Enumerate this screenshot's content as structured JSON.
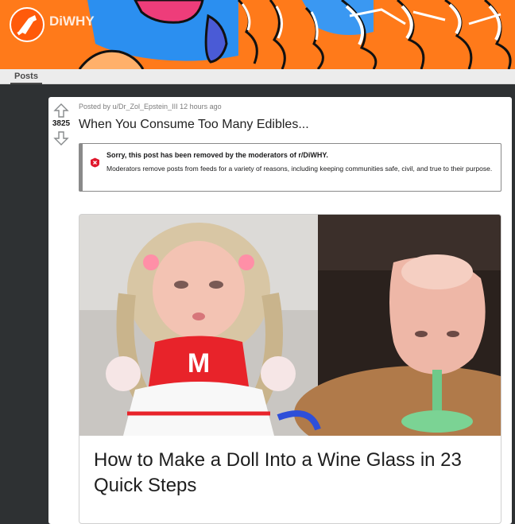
{
  "subreddit": {
    "name": "DiWHY",
    "logo_icon": "diwhy-logo-icon",
    "banner_color": "#ff7a1a"
  },
  "tabs": [
    {
      "label": "Posts",
      "active": true
    }
  ],
  "post": {
    "vote_count": "3825",
    "upvote_icon": "upvote-arrow-icon",
    "downvote_icon": "downvote-arrow-icon",
    "meta": "Posted by u/Dr_Zol_Epstein_III 12 hours ago",
    "title": "When You Consume Too Many Edibles...",
    "removal_notice": {
      "icon": "removed-x-icon",
      "heading": "Sorry, this post has been removed by the moderators of r/DiWHY.",
      "body": "Moderators remove posts from feeds for a variety of reasons, including keeping communities safe, civil, and true to their purpose."
    },
    "preview": {
      "image_description_icon": "doll-wine-glass-image",
      "overlay_title": "How to Make a Doll Into a Wine Glass in 23 Quick Steps",
      "doll_shirt_letter": "M"
    }
  }
}
